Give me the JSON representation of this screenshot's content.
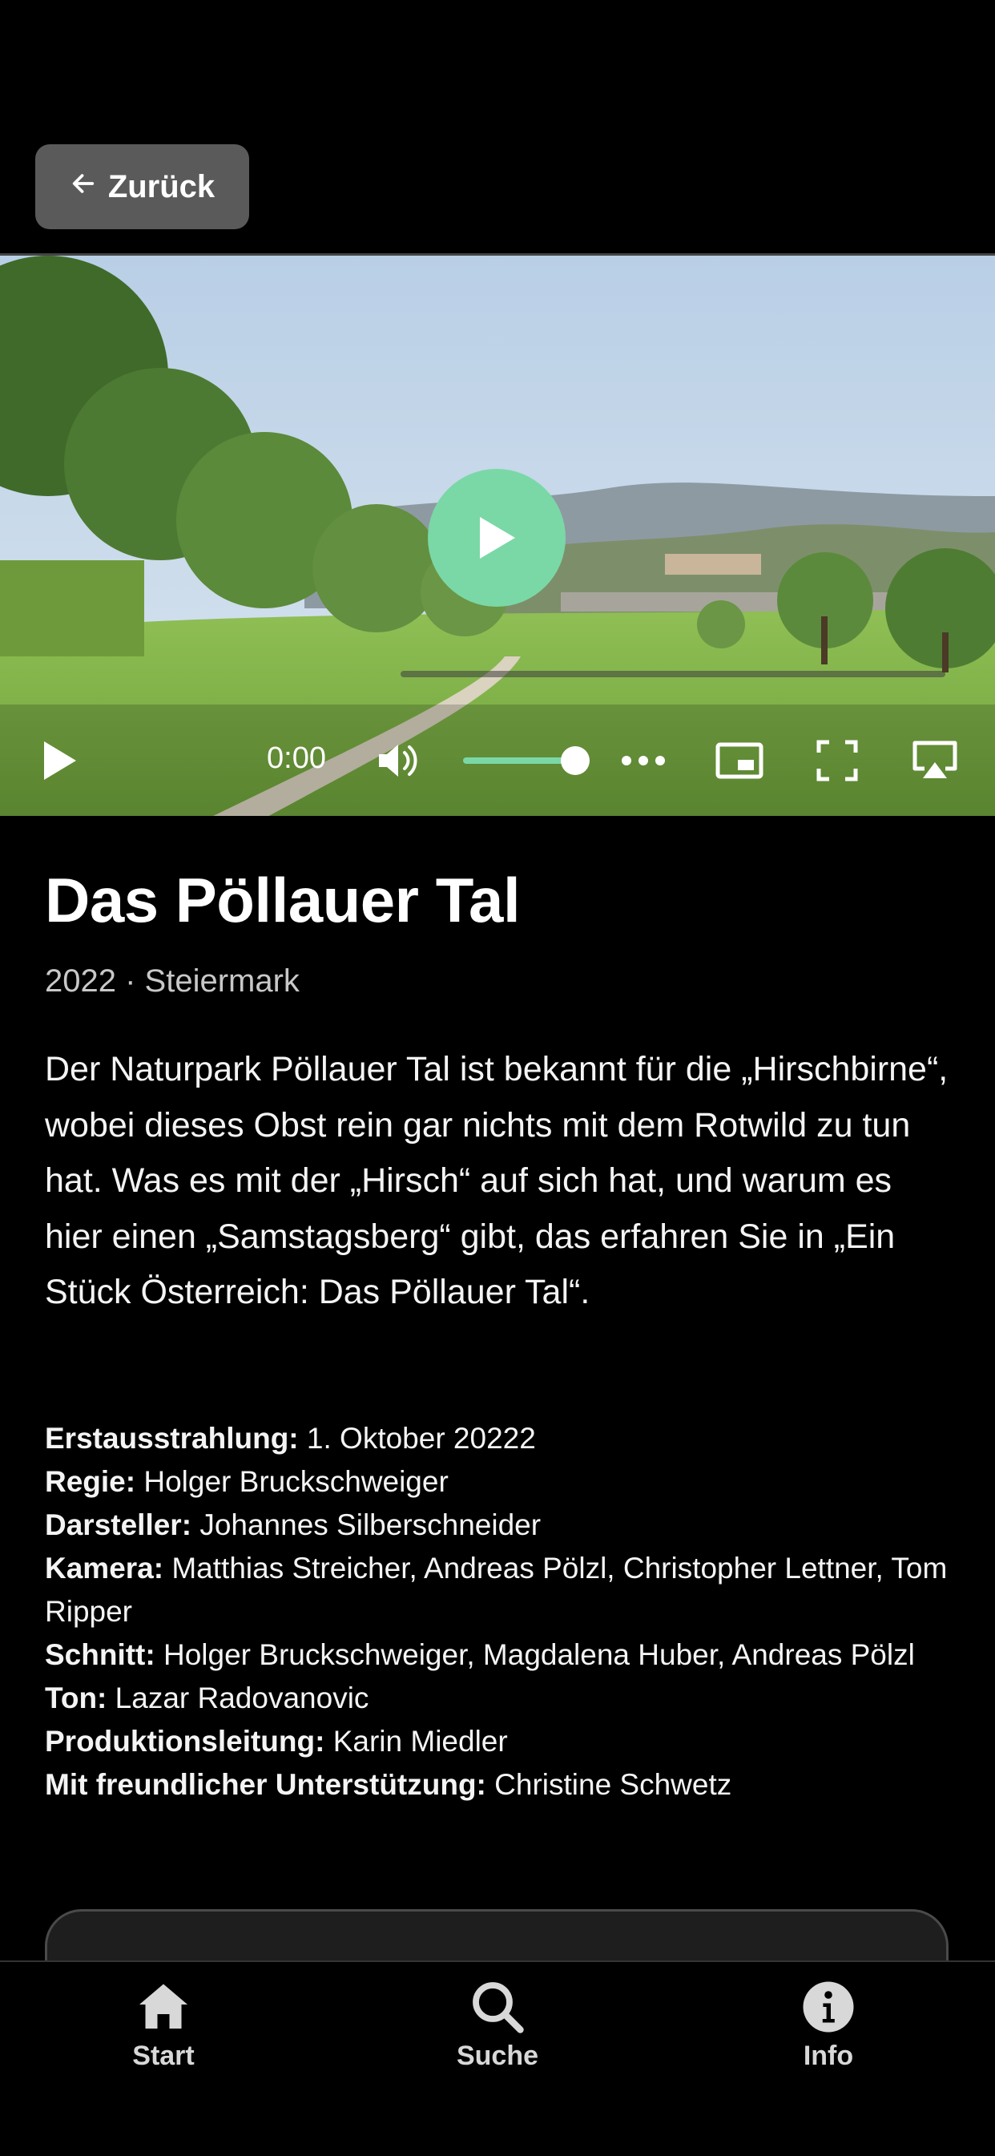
{
  "nav": {
    "back_label": "Zurück"
  },
  "player": {
    "time": "0:00",
    "volume_level": 0.85,
    "progress": 0,
    "accent_color": "#7ad8a6",
    "icons": [
      "play-icon",
      "volume-icon",
      "more-icon",
      "pip-icon",
      "fullscreen-icon",
      "airplay-icon"
    ]
  },
  "episode": {
    "title": "Das Pöllauer Tal",
    "meta": "2022 · Steiermark",
    "description": "Der Naturpark Pöllauer Tal ist bekannt für die „Hirschbirne“, wobei dieses Obst rein gar nichts mit dem Rotwild zu tun hat. Was es mit der „Hirsch“ auf sich hat, und warum es hier einen „Samstagsberg“ gibt, das erfahren Sie in „Ein Stück Österreich: Das Pöllauer Tal“."
  },
  "credits": [
    {
      "label": "Erstausstrahlung:",
      "value": "1. Oktober 20222"
    },
    {
      "label": "Regie:",
      "value": "Holger Bruckschweiger"
    },
    {
      "label": "Darsteller:",
      "value": "Johannes Silberschneider"
    },
    {
      "label": "Kamera:",
      "value": "Matthias Streicher, Andreas Pölzl, Christopher Lettner, Tom Ripper"
    },
    {
      "label": "Schnitt:",
      "value": "Holger Bruckschweiger, Magdalena Huber, Andreas Pölzl"
    },
    {
      "label": "Ton:",
      "value": "Lazar Radovanovic"
    },
    {
      "label": "Produktionsleitung:",
      "value": "Karin Miedler"
    },
    {
      "label": "Mit freundlicher Unterstützung:",
      "value": "Christine Schwetz"
    }
  ],
  "tabbar": {
    "items": [
      {
        "label": "Start",
        "icon": "home-icon"
      },
      {
        "label": "Suche",
        "icon": "search-icon"
      },
      {
        "label": "Info",
        "icon": "info-icon"
      }
    ]
  }
}
